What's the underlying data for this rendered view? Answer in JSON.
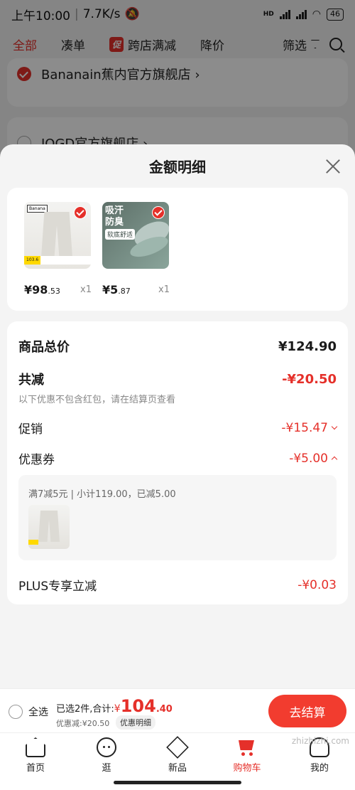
{
  "status_bar": {
    "time": "上午10:00",
    "speed": "7.7K/s",
    "network": "HD",
    "battery": "46"
  },
  "filter_bar": {
    "tabs": [
      {
        "label": "全部",
        "active": true
      },
      {
        "label": "凑单",
        "active": false
      },
      {
        "label": "跨店满减",
        "active": false,
        "tag": "促"
      },
      {
        "label": "降价",
        "active": false
      }
    ],
    "filter_label": "筛选"
  },
  "stores": [
    {
      "name": "Bananain蕉内官方旗舰店 ›",
      "checked": true
    },
    {
      "name": "JOGD官方旗舰店 ›",
      "checked": false
    }
  ],
  "sheet": {
    "title": "金额明细",
    "goods": [
      {
        "thumb": "pants",
        "brand": "Banana",
        "tag": "103.6",
        "price_int": "¥98",
        "price_dec": ".53",
        "qty": "x1"
      },
      {
        "thumb": "insole",
        "line1": "吸汗",
        "line2": "防臭",
        "sub": "软底舒适",
        "price_int": "¥5",
        "price_dec": ".87",
        "qty": "x1"
      }
    ],
    "total_label": "商品总价",
    "total_value": "¥124.90",
    "reduce_label": "共减",
    "reduce_value": "-¥20.50",
    "reduce_note": "以下优惠不包含红包，请在结算页查看",
    "promo_label": "促销",
    "promo_value": "-¥15.47",
    "coupon_label": "优惠券",
    "coupon_value": "-¥5.00",
    "coupon_desc": "满7减5元 | 小计119.00，已减5.00",
    "plus_label": "PLUS专享立减",
    "plus_value": "-¥0.03"
  },
  "checkout": {
    "select_all": "全选",
    "summary_prefix": "已选2件,合计:",
    "yen": "¥",
    "amount_int": "104",
    "amount_dec": ".40",
    "discount": "优惠减:¥20.50",
    "detail_tag": "优惠明细",
    "pay_button": "去结算"
  },
  "tabbar": [
    {
      "label": "首页",
      "icon": "home-icon"
    },
    {
      "label": "逛",
      "icon": "face-icon"
    },
    {
      "label": "新品",
      "icon": "box-icon"
    },
    {
      "label": "购物车",
      "icon": "cart-icon",
      "active": true
    },
    {
      "label": "我的",
      "icon": "user-icon"
    }
  ],
  "watermark": "zhizhizhi.com",
  "colors": {
    "accent": "#e5302a",
    "pay_button": "#f23c2f"
  }
}
